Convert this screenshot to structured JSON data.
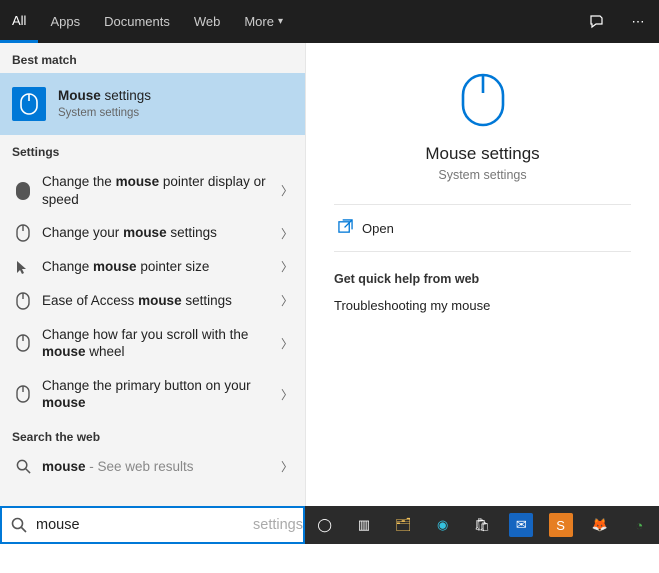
{
  "topbar": {
    "tabs": {
      "all": "All",
      "apps": "Apps",
      "documents": "Documents",
      "web": "Web",
      "more": "More"
    }
  },
  "sections": {
    "best_match": "Best match",
    "settings": "Settings",
    "search_web": "Search the web"
  },
  "best": {
    "title_html": "<b>Mouse</b> settings",
    "subtitle": "System settings"
  },
  "settings_items": [
    {
      "icon": "mouse-glyph-icon",
      "html": "Change the <b>mouse</b> pointer display or speed"
    },
    {
      "icon": "mouse-outline-icon",
      "html": "Change your <b>mouse</b> settings"
    },
    {
      "icon": "pointer-size-icon",
      "html": "Change <b>mouse</b> pointer size"
    },
    {
      "icon": "mouse-outline-icon",
      "html": "Ease of Access <b>mouse</b> settings"
    },
    {
      "icon": "mouse-outline-icon",
      "html": "Change how far you scroll with the <b>mouse</b> wheel"
    },
    {
      "icon": "mouse-outline-icon",
      "html": "Change the primary button on your <b>mouse</b>"
    }
  ],
  "web_item": {
    "term_html": "<b>mouse</b>",
    "suffix": " - See web results"
  },
  "detail": {
    "title": "Mouse settings",
    "subtitle": "System settings",
    "open_label": "Open",
    "web_help_header": "Get quick help from web",
    "web_help_item": "Troubleshooting my mouse"
  },
  "search": {
    "value": "mouse",
    "placeholder": "settings"
  },
  "taskbar": [
    {
      "name": "cortana-icon",
      "glyph": "◯",
      "color": "#fff",
      "bg": "transparent"
    },
    {
      "name": "taskview-icon",
      "glyph": "▥",
      "color": "#fff",
      "bg": "transparent"
    },
    {
      "name": "file-explorer-icon",
      "glyph": "🗂",
      "color": "#f6c35a",
      "bg": "transparent"
    },
    {
      "name": "edge-icon",
      "glyph": "◉",
      "color": "#35c1de",
      "bg": "transparent"
    },
    {
      "name": "store-icon",
      "glyph": "🛍",
      "color": "#fff",
      "bg": "transparent"
    },
    {
      "name": "mail-icon",
      "glyph": "✉",
      "color": "#fff",
      "bg": "#1565c0"
    },
    {
      "name": "sublime-icon",
      "glyph": "S",
      "color": "#fff",
      "bg": "#e67e22"
    },
    {
      "name": "firefox-icon",
      "glyph": "🦊",
      "color": "#ff7b00",
      "bg": "transparent"
    },
    {
      "name": "chrome-icon",
      "glyph": "◔",
      "color": "#4caf50",
      "bg": "transparent"
    }
  ]
}
